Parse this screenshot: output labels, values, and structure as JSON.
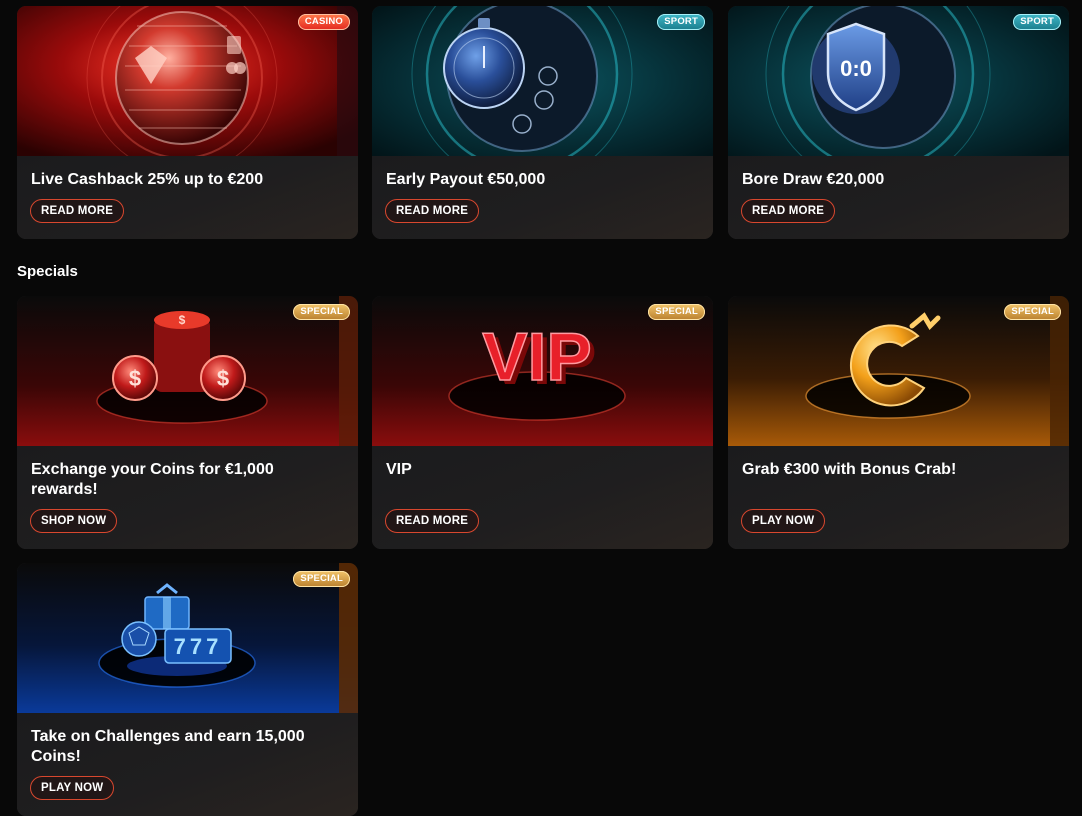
{
  "promotions": [
    {
      "badge": "CASINO",
      "title": "Live Cashback 25% up to €200",
      "button": "READ MORE"
    },
    {
      "badge": "SPORT",
      "title": "Early Payout €50,000",
      "button": "READ MORE"
    },
    {
      "badge": "SPORT",
      "title": "Bore Draw €20,000",
      "button": "READ MORE"
    }
  ],
  "specials": {
    "heading": "Specials",
    "items": [
      {
        "badge": "SPECIAL",
        "title": "Exchange your Coins for €1,000 rewards!",
        "button": "SHOP NOW"
      },
      {
        "badge": "SPECIAL",
        "title": "VIP",
        "button": "READ MORE"
      },
      {
        "badge": "SPECIAL",
        "title": "Grab €300 with Bonus Crab!",
        "button": "PLAY NOW"
      },
      {
        "badge": "SPECIAL",
        "title": "Take on Challenges and earn 15,000 Coins!",
        "button": "PLAY NOW"
      }
    ]
  },
  "art_text": {
    "vip_logo": "VIP",
    "score_shield": "0:0",
    "slot_reels": "777"
  },
  "colors": {
    "casino_badge": "#e4281f",
    "sport_badge": "#1a7d8d",
    "special_badge": "#c8903a",
    "button_border": "#d8472e",
    "page_bg": "#080808"
  }
}
